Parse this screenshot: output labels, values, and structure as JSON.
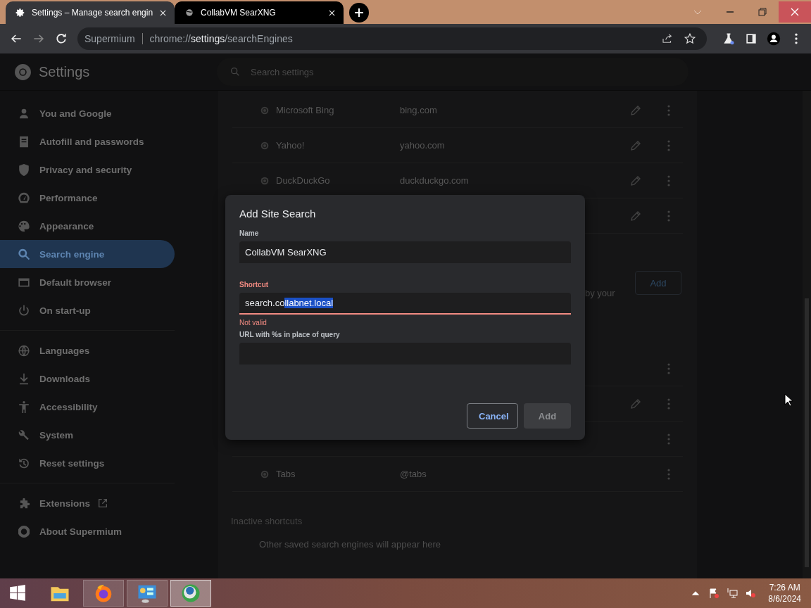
{
  "tabs": [
    {
      "title": "Settings – Manage search engin",
      "selected": true
    },
    {
      "title": "CollabVM SearXNG",
      "selected": false
    }
  ],
  "address_bar": {
    "site_label": "Supermium",
    "url_scheme": "chrome://",
    "url_host": "settings",
    "url_path": "/searchEngines"
  },
  "settings_header": {
    "title": "Settings",
    "search_placeholder": "Search settings"
  },
  "sidebar": {
    "groups": [
      [
        {
          "label": "You and Google",
          "selected": false
        },
        {
          "label": "Autofill and passwords",
          "selected": false
        },
        {
          "label": "Privacy and security",
          "selected": false
        },
        {
          "label": "Performance",
          "selected": false
        },
        {
          "label": "Appearance",
          "selected": false
        },
        {
          "label": "Search engine",
          "selected": true
        },
        {
          "label": "Default browser",
          "selected": false
        },
        {
          "label": "On start-up",
          "selected": false
        }
      ],
      [
        {
          "label": "Languages",
          "selected": false
        },
        {
          "label": "Downloads",
          "selected": false
        },
        {
          "label": "Accessibility",
          "selected": false
        },
        {
          "label": "System",
          "selected": false
        },
        {
          "label": "Reset settings",
          "selected": false
        }
      ],
      [
        {
          "label": "Extensions",
          "selected": false,
          "external": true
        },
        {
          "label": "About Supermium",
          "selected": false,
          "external": false
        }
      ]
    ]
  },
  "search_engines": [
    {
      "name": "Microsoft Bing",
      "keyword": "bing.com",
      "editable": true
    },
    {
      "name": "Yahoo!",
      "keyword": "yahoo.com",
      "editable": true
    },
    {
      "name": "DuckDuckGo",
      "keyword": "duckduckgo.com",
      "editable": true
    },
    {
      "editable": true
    }
  ],
  "site_search": {
    "description_tail": "by your",
    "add_button": "Add"
  },
  "site_search_rows": [
    {
      "editable": false
    },
    {
      "editable": true
    },
    {
      "editable": false
    },
    {
      "name": "Tabs",
      "keyword": "@tabs",
      "editable": false
    }
  ],
  "inactive_shortcuts": {
    "title": "Inactive shortcuts",
    "empty_text": "Other saved search engines will appear here"
  },
  "dialog": {
    "title": "Add Site Search",
    "fields": [
      {
        "label": "Name",
        "text": "CollabVM SearXNG",
        "invalid": false
      },
      {
        "label": "Shortcut",
        "text": "search.co",
        "selected_text": "llabnet.local",
        "invalid": true,
        "error": "Not valid"
      },
      {
        "label": "URL with %s in place of query",
        "invalid": false
      }
    ],
    "buttons": [
      {
        "label": "Cancel",
        "kind": "secondary",
        "disabled": false
      },
      {
        "label": "Add",
        "kind": "primary",
        "disabled": true
      }
    ]
  },
  "taskbar": {
    "apps": [
      {
        "selected": false
      },
      {
        "selected": false
      },
      {
        "selected": false
      },
      {
        "selected": true
      }
    ],
    "clock_time": "7:26 AM",
    "clock_date": "8/6/2024"
  }
}
